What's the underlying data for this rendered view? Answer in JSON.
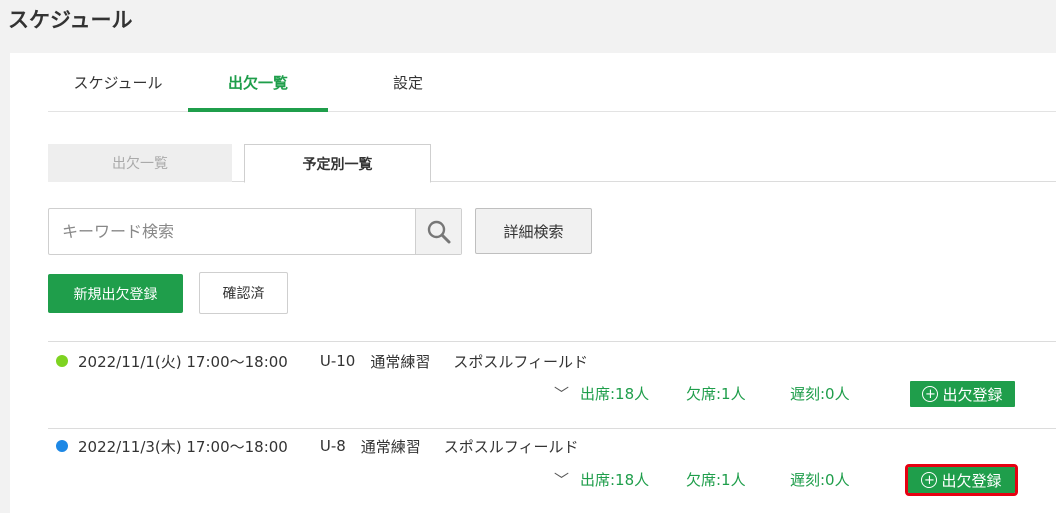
{
  "page_title": "スケジュール",
  "tabs": [
    {
      "label": "スケジュール",
      "active": false
    },
    {
      "label": "出欠一覧",
      "active": true
    },
    {
      "label": "設定",
      "active": false
    }
  ],
  "subtabs": [
    {
      "label": "出欠一覧",
      "active": false
    },
    {
      "label": "予定別一覧",
      "active": true
    }
  ],
  "search": {
    "placeholder": "キーワード検索",
    "value": ""
  },
  "buttons": {
    "detail_search": "詳細検索",
    "new_attendance": "新規出欠登録",
    "confirmed": "確認済"
  },
  "colors": {
    "accent": "#1f9e4b",
    "highlight": "#e60012"
  },
  "events": [
    {
      "dot_color": "#7ed321",
      "datetime": "2022/11/1(火) 17:00〜18:00",
      "team": "U-10",
      "type": "通常練習",
      "place": "スポスルフィールド",
      "present": "出席:18人",
      "absent": "欠席:1人",
      "late": "遅刻:0人",
      "register_label": "出欠登録",
      "highlighted": false
    },
    {
      "dot_color": "#1e88e5",
      "datetime": "2022/11/3(木) 17:00〜18:00",
      "team": "U-8",
      "type": "通常練習",
      "place": "スポスルフィールド",
      "present": "出席:18人",
      "absent": "欠席:1人",
      "late": "遅刻:0人",
      "register_label": "出欠登録",
      "highlighted": true
    }
  ]
}
